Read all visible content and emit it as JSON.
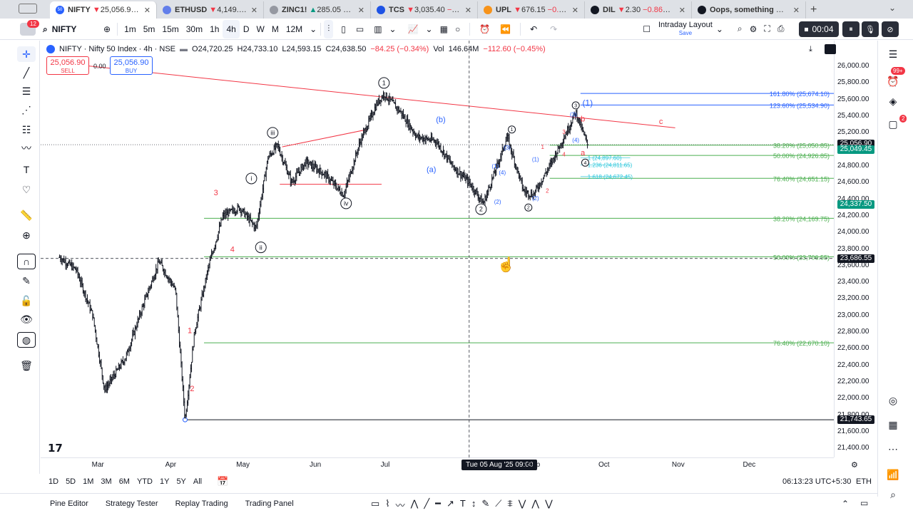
{
  "browser": {
    "avatar_badge": "12",
    "tabs": [
      {
        "title": "NIFTY",
        "price": "25,056.90",
        "change": "−0.",
        "dir": "down",
        "fav_color": "#2962ff",
        "fav_text": "50",
        "active": true
      },
      {
        "title": "ETHUSD",
        "price": "4,149.41",
        "change": "−0.",
        "dir": "down",
        "fav_color": "#627eea",
        "fav_text": ""
      },
      {
        "title": "ZINC1!",
        "price": "285.05",
        "change": "+2.2",
        "dir": "up",
        "fav_color": "#9598a1",
        "fav_text": ""
      },
      {
        "title": "TCS",
        "price": "3,035.40",
        "change": "−0.88%",
        "dir": "down",
        "fav_color": "#1e53e5",
        "fav_text": ""
      },
      {
        "title": "UPL",
        "price": "676.15",
        "change": "−0.16%",
        "dir": "down",
        "fav_color": "#f7931a",
        "fav_text": ""
      },
      {
        "title": "DIL",
        "price": "2.30",
        "change": "−0.86% / Inf",
        "dir": "down",
        "fav_color": "#131722",
        "fav_text": ""
      },
      {
        "title": "Oops, something went w",
        "price": "",
        "change": "",
        "dir": "",
        "fav_color": "#131722",
        "fav_text": ""
      }
    ],
    "new_tab": "+",
    "tab_menu": "⌄"
  },
  "toolbar": {
    "symbol": "NIFTY",
    "intervals": [
      "1m",
      "5m",
      "15m",
      "30m",
      "1h",
      "4h",
      "D",
      "W",
      "M",
      "12M"
    ],
    "active_interval": "4h",
    "layout_name": "Intraday Layout",
    "layout_sub": "Save",
    "rec_time": "00:04"
  },
  "legend": {
    "name": "NIFTY · Nifty 50 Index · 4h · NSE",
    "o": "O24,720.25",
    "h": "H24,733.10",
    "l": "L24,593.15",
    "c": "C24,638.50",
    "chg": "−84.25 (−0.34%)",
    "vol_label": "Vol",
    "vol": "146.64M",
    "vol_chg": "−112.60 (−0.45%)"
  },
  "trade": {
    "sell_price": "25,056.90",
    "sell_label": "SELL",
    "spread": "0.00",
    "buy_price": "25,056.90",
    "buy_label": "BUY"
  },
  "chart_data": {
    "type": "candlestick",
    "symbol": "NIFTY",
    "interval": "4h",
    "ylim": [
      21400,
      26200
    ],
    "price_ticks": [
      26000,
      25800,
      25600,
      25400,
      25200,
      25000,
      24800,
      24600,
      24400,
      24200,
      24000,
      23800,
      23600,
      23400,
      23200,
      23000,
      22800,
      22600,
      22400,
      22200,
      22000,
      21800,
      21600,
      21400
    ],
    "price_tick_labels": [
      "26,000.00",
      "25,800.00",
      "25,600.00",
      "25,400.00",
      "25,200.00",
      "25,000.00",
      "24,800.00",
      "24,600.00",
      "24,400.00",
      "24,200.00",
      "24,000.00",
      "23,800.00",
      "23,600.00",
      "23,400.00",
      "23,200.00",
      "23,000.00",
      "22,800.00",
      "22,600.00",
      "22,400.00",
      "22,200.00",
      "22,000.00",
      "21,800.00",
      "21,600.00",
      "21,400.00"
    ],
    "time_ticks": [
      "Mar",
      "Apr",
      "May",
      "Jun",
      "Jul",
      "Aug",
      "Sep",
      "Oct",
      "Nov",
      "Dec"
    ],
    "crosshair_time": "Tue 05 Aug '25   09:00",
    "price_path": [
      [
        "2025-02-13",
        23700
      ],
      [
        "2025-02-20",
        23550
      ],
      [
        "2025-02-27",
        23000
      ],
      [
        "2025-03-04",
        22100
      ],
      [
        "2025-03-13",
        22500
      ],
      [
        "2025-03-20",
        23100
      ],
      [
        "2025-03-27",
        23650
      ],
      [
        "2025-04-03",
        23300
      ],
      [
        "2025-04-07",
        21743.65
      ],
      [
        "2025-04-11",
        22800
      ],
      [
        "2025-04-17",
        23600
      ],
      [
        "2025-04-23",
        24200
      ],
      [
        "2025-04-30",
        24300
      ],
      [
        "2025-05-07",
        24050
      ],
      [
        "2025-05-12",
        24900
      ],
      [
        "2025-05-16",
        25050
      ],
      [
        "2025-05-22",
        24600
      ],
      [
        "2025-05-28",
        24850
      ],
      [
        "2025-06-05",
        24700
      ],
      [
        "2025-06-13",
        24450
      ],
      [
        "2025-06-20",
        25100
      ],
      [
        "2025-06-27",
        25550
      ],
      [
        "2025-06-30",
        25669
      ],
      [
        "2025-07-07",
        25450
      ],
      [
        "2025-07-14",
        25150
      ],
      [
        "2025-07-22",
        25100
      ],
      [
        "2025-07-29",
        24800
      ],
      [
        "2025-08-05",
        24600
      ],
      [
        "2025-08-11",
        24350
      ],
      [
        "2025-08-18",
        24900
      ],
      [
        "2025-08-21",
        25150
      ],
      [
        "2025-08-28",
        24500
      ],
      [
        "2025-09-01",
        24450
      ],
      [
        "2025-09-08",
        24800
      ],
      [
        "2025-09-15",
        25200
      ],
      [
        "2025-09-19",
        25450
      ],
      [
        "2025-09-24",
        25050
      ]
    ],
    "horizontal_levels": [
      {
        "label": "161.80% (25,674.10)",
        "price": 25674.1,
        "color": "#2962ff"
      },
      {
        "label": "123.60% (25,534.90)",
        "price": 25534.9,
        "color": "#2962ff"
      },
      {
        "label": "38.20% (25,050.85)",
        "price": 25050.85,
        "color": "#4caf50"
      },
      {
        "label": "50.00% (24,926.85)",
        "price": 24926.85,
        "color": "#4caf50"
      },
      {
        "label": "76.40% (24,651.15)",
        "price": 24651.15,
        "color": "#4caf50"
      },
      {
        "label": "38.20% (24,169.75)",
        "price": 24169.75,
        "color": "#4caf50"
      },
      {
        "label": "50.00% (23,706.55)",
        "price": 23706.55,
        "color": "#4caf50"
      },
      {
        "label": "76.40% (22,670.10)",
        "price": 22670.1,
        "color": "#4caf50"
      }
    ],
    "small_levels": [
      {
        "label": "1 (24,897.60)",
        "price": 24897.6
      },
      {
        "label": "1.236 (24,811.65)",
        "price": 24811.65
      },
      {
        "label": "1.618 (24,672.45)",
        "price": 24672.45
      }
    ],
    "price_tags": [
      {
        "label": "25,056.90",
        "price": 25056.9,
        "color": "#131722"
      },
      {
        "label": "25,049.45",
        "price": 25049.45,
        "color": "#089981"
      },
      {
        "label": "24,337.50",
        "price": 24337.5,
        "color": "#089981"
      },
      {
        "label": "23,686.55",
        "price": 23686.55,
        "color": "#131722"
      },
      {
        "label": "21,743.65",
        "price": 21743.65,
        "color": "#131722"
      }
    ],
    "wave_labels": [
      {
        "text": "1",
        "date": "2025-06-30",
        "price": 25800,
        "style": "circle-black"
      },
      {
        "text": "2",
        "date": "2025-08-10",
        "price": 24280,
        "style": "circle-black"
      },
      {
        "text": "2",
        "date": "2025-08-30",
        "price": 24300,
        "style": "circle-black-small"
      },
      {
        "text": "3",
        "date": "2025-09-19",
        "price": 25530,
        "style": "circle-black-small"
      },
      {
        "text": "4",
        "date": "2025-09-23",
        "price": 24840,
        "style": "circle-black-small"
      },
      {
        "text": "iii",
        "date": "2025-05-14",
        "price": 25200,
        "style": "circle-black"
      },
      {
        "text": "i",
        "date": "2025-05-05",
        "price": 24650,
        "style": "circle-black"
      },
      {
        "text": "ii",
        "date": "2025-05-09",
        "price": 23820,
        "style": "circle-black"
      },
      {
        "text": "iv",
        "date": "2025-06-14",
        "price": 24350,
        "style": "circle-black"
      },
      {
        "text": "(b)",
        "date": "2025-07-24",
        "price": 25360,
        "style": "blue"
      },
      {
        "text": "(a)",
        "date": "2025-07-20",
        "price": 24760,
        "style": "blue"
      },
      {
        "text": "(1)",
        "date": "2025-09-24",
        "price": 25560,
        "style": "blue-large"
      },
      {
        "text": "1",
        "date": "2025-08-23",
        "price": 25240,
        "style": "circle-black-small"
      },
      {
        "text": "(3)",
        "date": "2025-08-21",
        "price": 25020,
        "style": "blue-small"
      },
      {
        "text": "(1)",
        "date": "2025-08-16",
        "price": 24800,
        "style": "blue-small"
      },
      {
        "text": "(4)",
        "date": "2025-08-19",
        "price": 24720,
        "style": "blue-small"
      },
      {
        "text": "(2)",
        "date": "2025-08-17",
        "price": 24370,
        "style": "blue-small"
      },
      {
        "text": "(1)",
        "date": "2025-09-02",
        "price": 24880,
        "style": "blue-small"
      },
      {
        "text": "(2)",
        "date": "2025-09-02",
        "price": 24410,
        "style": "blue-small"
      },
      {
        "text": "(3)",
        "date": "2025-09-18",
        "price": 25420,
        "style": "blue-small"
      },
      {
        "text": "(4)",
        "date": "2025-09-19",
        "price": 25110,
        "style": "blue-small"
      },
      {
        "text": "3",
        "date": "2025-04-20",
        "price": 24480,
        "style": "red"
      },
      {
        "text": "4",
        "date": "2025-04-27",
        "price": 23800,
        "style": "red"
      },
      {
        "text": "1",
        "date": "2025-04-09",
        "price": 22820,
        "style": "red"
      },
      {
        "text": "2",
        "date": "2025-04-10",
        "price": 22120,
        "style": "red"
      },
      {
        "text": "1",
        "date": "2025-09-05",
        "price": 25030,
        "style": "red-small"
      },
      {
        "text": "2",
        "date": "2025-09-07",
        "price": 24500,
        "style": "red-small"
      },
      {
        "text": "3",
        "date": "2025-09-14",
        "price": 25210,
        "style": "red-small"
      },
      {
        "text": "4",
        "date": "2025-09-14",
        "price": 24940,
        "style": "red-small"
      },
      {
        "text": "b",
        "date": "2025-09-22",
        "price": 25370,
        "style": "red"
      },
      {
        "text": "a",
        "date": "2025-09-22",
        "price": 24960,
        "style": "red"
      },
      {
        "text": "c",
        "date": "2025-10-25",
        "price": 25340,
        "style": "red"
      }
    ],
    "trendline": {
      "from": [
        "2025-02-10",
        26050
      ],
      "to": [
        "2025-10-31",
        25260
      ],
      "color": "#f23645"
    },
    "triangle": {
      "upper": {
        "from": [
          "2025-05-18",
          25030
        ],
        "to": [
          "2025-06-23",
          25240
        ]
      },
      "lower": {
        "from": [
          "2025-05-17",
          24580
        ],
        "to": [
          "2025-06-29",
          24580
        ]
      }
    },
    "crosshair": {
      "date": "2025-08-05",
      "price": 23686.55
    },
    "dotted_hline_price": 25056.9,
    "bottom_line_price": 21743.65
  },
  "icons": {
    "menu": "☰",
    "search": "⌕",
    "compare": "⊕",
    "indicators": "ƒx",
    "alert": "⏰",
    "replay": "⏪",
    "undo": "↶",
    "redo": "↷",
    "settings": "⚙",
    "fullscreen": "⛶",
    "camera": "📷",
    "pause": "⏸",
    "mic": "🎙"
  },
  "range": {
    "items": [
      "1D",
      "5D",
      "1M",
      "3M",
      "6M",
      "YTD",
      "1Y",
      "5Y",
      "All"
    ],
    "clock": "06:13:23 UTC+5:30",
    "session": "ETH"
  },
  "bottom_tabs": [
    "Pine Editor",
    "Strategy Tester",
    "Replay Trading",
    "Trading Panel"
  ],
  "rightbar": {
    "badge1": "99+",
    "badge2": "2"
  },
  "colors": {
    "up": "#089981",
    "down": "#f23645",
    "accent": "#2962ff",
    "fib_green": "#4caf50"
  }
}
